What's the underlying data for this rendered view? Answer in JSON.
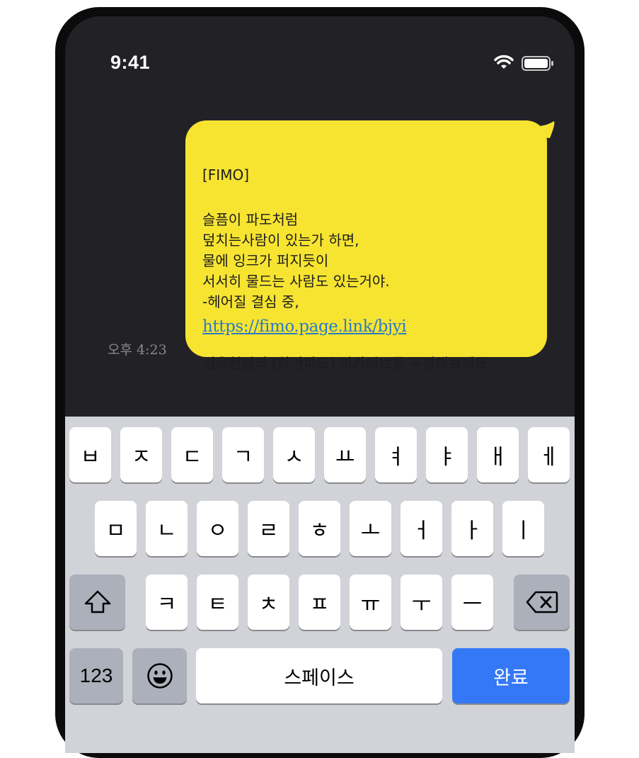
{
  "status_bar": {
    "time": "9:41"
  },
  "message": {
    "header": "[FIMO]",
    "body": "슬픔이 파도처럼\n덮치는사람이 있는가 하면,\n물에 잉크가 퍼지듯이\n서서히 물드는 사람도 있는거야.\n-헤어질 결심 중,",
    "archive": "김옥현님의 [하얀파도] 아카이브를 구경해보세요.",
    "link": "https://fimo.page.link/bjyi ",
    "time": "오후 4:23"
  },
  "keyboard": {
    "row1": [
      "ㅂ",
      "ㅈ",
      "ㄷ",
      "ㄱ",
      "ㅅ",
      "ㅛ",
      "ㅕ",
      "ㅑ",
      "ㅐ",
      "ㅔ"
    ],
    "row2": [
      "ㅁ",
      "ㄴ",
      "ㅇ",
      "ㄹ",
      "ㅎ",
      "ㅗ",
      "ㅓ",
      "ㅏ",
      "ㅣ"
    ],
    "row3": [
      "ㅋ",
      "ㅌ",
      "ㅊ",
      "ㅍ",
      "ㅠ",
      "ㅜ",
      "ㅡ"
    ],
    "numbers_label": "123",
    "space_label": "스페이스",
    "done_label": "완료"
  },
  "colors": {
    "bubble": "#f7e431",
    "screen": "#222226",
    "keyboard": "#d1d3d9",
    "done": "#3478f6",
    "link": "#2a7cc7"
  }
}
